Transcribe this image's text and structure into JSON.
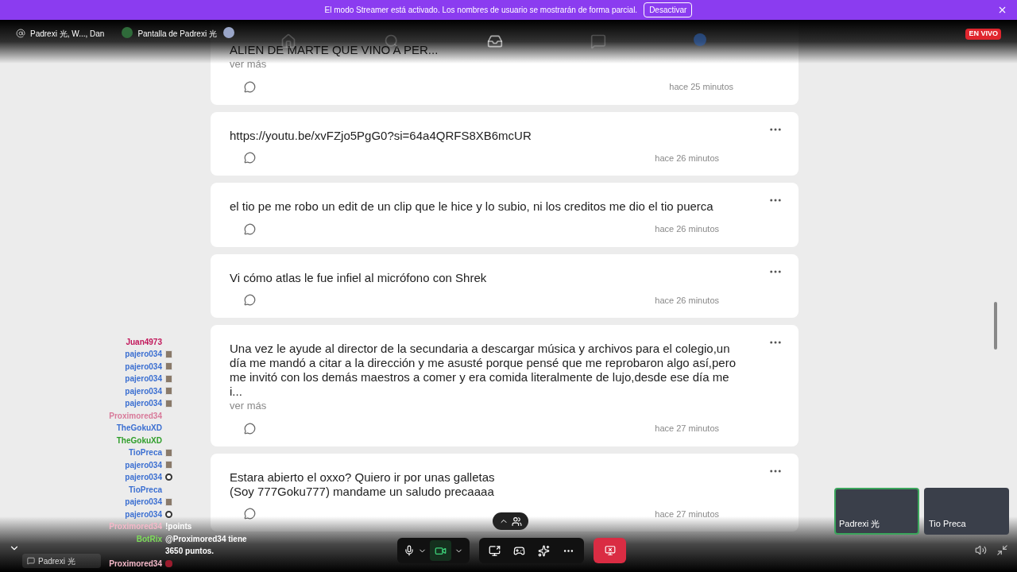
{
  "banner": {
    "message": "El modo Streamer está activado. Los nombres de usuario se mostrarán de forma parcial.",
    "button": "Desactivar"
  },
  "call_header": {
    "participants": "Padrexi 光, W..., Dan",
    "screen_title": "Pantalla de Padrexi 光",
    "live_badge": "EN VIVO"
  },
  "posts": [
    {
      "text": "ALIEN DE MARTE QUE VINO A PER...",
      "more": "ver más",
      "time": "hace 25 minutos",
      "cut_top": true
    },
    {
      "text": "https://youtu.be/xvFZjo5PgG0?si=64a4QRFS8XB6mcUR",
      "time": "hace 26 minutos",
      "cut_top": false
    },
    {
      "text": "el tio pe me robo un edit de un clip que le hice y lo subio, ni los creditos me dio el tio puerca",
      "time": "hace 26 minutos",
      "cut_top": false
    },
    {
      "text": "Vi cómo atlas le fue infiel al micrófono con Shrek",
      "time": "hace 26 minutos",
      "cut_top": false
    },
    {
      "text": "Una vez le ayude al director de la secundaria a descargar música y archivos para el colegio,un día me mandó a citar a la dirección y me asusté porque pensé que me reprobaron algo así,pero me invitó con los demás maestros a comer y era comida literalmente de lujo,desde ese día me i...",
      "more": "ver más",
      "time": "hace 27 minutos",
      "cut_top": false
    },
    {
      "text": "Estara abierto el oxxo? Quiero ir por unas galletas\n(Soy 777Goku777) mandame un saludo precaaaa",
      "time": "hace 27 minutos",
      "cut_top": false
    }
  ],
  "chat": [
    {
      "name": "Juan4973",
      "color": "#c2185b",
      "kind": "blank"
    },
    {
      "name": "pajero034",
      "color": "#3b6fd1",
      "kind": "face"
    },
    {
      "name": "pajero034",
      "color": "#3b6fd1",
      "kind": "face"
    },
    {
      "name": "pajero034",
      "color": "#3b6fd1",
      "kind": "face"
    },
    {
      "name": "pajero034",
      "color": "#3b6fd1",
      "kind": "face"
    },
    {
      "name": "pajero034",
      "color": "#3b6fd1",
      "kind": "face"
    },
    {
      "name": "Proximored34",
      "color": "#d87a9a",
      "kind": "blank"
    },
    {
      "name": "TheGokuXD",
      "color": "#3b6fd1",
      "kind": "blank"
    },
    {
      "name": "TheGokuXD",
      "color": "#2f9e2a",
      "kind": "blank"
    },
    {
      "name": "TioPreca",
      "color": "#3b6fd1",
      "kind": "face"
    },
    {
      "name": "pajero034",
      "color": "#3b6fd1",
      "kind": "face"
    },
    {
      "name": "pajero034",
      "color": "#3b6fd1",
      "kind": "skull"
    },
    {
      "name": "TioPreca",
      "color": "#3b6fd1",
      "kind": "blank"
    },
    {
      "name": "pajero034",
      "color": "#3b6fd1",
      "kind": "face"
    },
    {
      "name": "pajero034",
      "color": "#3b6fd1",
      "kind": "skull"
    },
    {
      "name": "Proximored34",
      "color": "#f4b8c8",
      "kind": "text",
      "message": "!points"
    },
    {
      "name": "BotRix",
      "color": "#7ddc5a",
      "kind": "text",
      "message": "@Proximored34 tiene 3650 puntos."
    },
    {
      "name": "Proximored34",
      "color": "#f4b8c8",
      "kind": "heart"
    }
  ],
  "chat_input": {
    "placeholder": "Padrexi 光"
  },
  "controls": {
    "camera_on": true,
    "participants_expanded": false
  },
  "video_tiles": [
    {
      "name": "Padrexi 光",
      "speaking": true
    },
    {
      "name": "Tio Preca",
      "speaking": false
    }
  ]
}
